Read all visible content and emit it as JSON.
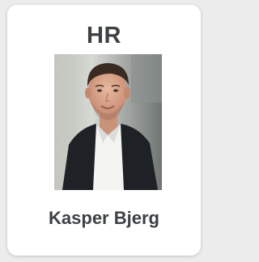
{
  "card": {
    "department": "HR",
    "name": "Kasper Bjerg"
  }
}
